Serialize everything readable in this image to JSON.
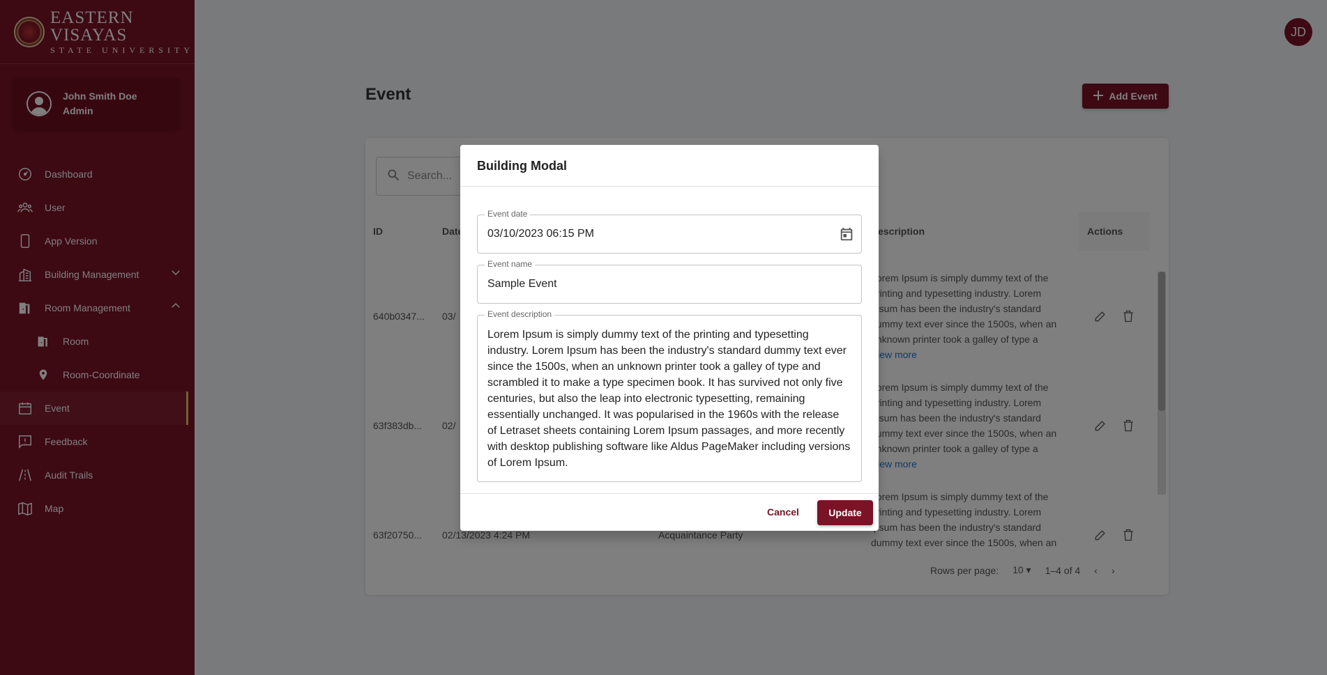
{
  "brand": {
    "line1": "EASTERN VISAYAS",
    "line2": "STATE UNIVERSITY"
  },
  "user": {
    "name": "John Smith Doe",
    "role": "Admin",
    "initials": "JD"
  },
  "sidebar": {
    "items": [
      {
        "label": "Dashboard",
        "icon": "dashboard-icon"
      },
      {
        "label": "User",
        "icon": "users-icon"
      },
      {
        "label": "App Version",
        "icon": "phone-icon"
      },
      {
        "label": "Building Management",
        "icon": "building-icon",
        "expand": "chevron-down-icon"
      },
      {
        "label": "Room Management",
        "icon": "door-icon",
        "expand": "chevron-up-icon"
      },
      {
        "label": "Room",
        "icon": "door-icon"
      },
      {
        "label": "Room-Coordinate",
        "icon": "pin-icon"
      },
      {
        "label": "Event",
        "icon": "calendar-icon",
        "active": true
      },
      {
        "label": "Feedback",
        "icon": "feedback-icon"
      },
      {
        "label": "Audit Trails",
        "icon": "road-icon"
      },
      {
        "label": "Map",
        "icon": "map-icon"
      }
    ]
  },
  "page": {
    "title": "Event",
    "add_button": "Add Event"
  },
  "table": {
    "search_placeholder": "Search...",
    "headers": {
      "id": "ID",
      "date": "Date",
      "description": "Description",
      "actions": "Actions"
    },
    "rows": [
      {
        "id": "640b0347...",
        "date": "03/",
        "desc": "Lorem Ipsum is simply dummy text of the printing and typesetting industry. Lorem Ipsum has been the industry's standard dummy text ever since the 1500s, when an unknown printer took a galley of type a",
        "view_more": "View more"
      },
      {
        "id": "63f383db...",
        "date": "02/",
        "desc": "Lorem Ipsum is simply dummy text of the printing and typesetting industry. Lorem Ipsum has been the industry's standard dummy text ever since the 1500s, when an unknown printer took a galley of type a",
        "view_more": "View more"
      },
      {
        "id": "63f20750...",
        "date": "02/13/2023 4:24 PM",
        "name": "Acquaintance Party",
        "desc": "Lorem Ipsum is simply dummy text of the printing and typesetting industry. Lorem Ipsum has been the industry's standard dummy text ever since the 1500s, when an"
      }
    ],
    "footer": {
      "rows_per_page_label": "Rows per page:",
      "rows_per_page": "10",
      "range": "1–4 of 4"
    }
  },
  "modal": {
    "title": "Building Modal",
    "date_label": "Event date",
    "date_value": "03/10/2023 06:15 PM",
    "name_label": "Event name",
    "name_value": "Sample Event",
    "desc_label": "Event description",
    "desc_value": "Lorem Ipsum is simply dummy text of the printing and typesetting industry. Lorem Ipsum has been the industry's standard dummy text ever since the 1500s, when an unknown printer took a galley of type and scrambled it to make a type specimen book. It has survived not only five centuries, but also the leap into electronic typesetting, remaining essentially unchanged. It was popularised in the 1960s with the release of Letraset sheets containing Lorem Ipsum passages, and more recently with desktop publishing software like Aldus PageMaker including versions of Lorem Ipsum.",
    "cancel": "Cancel",
    "update": "Update"
  },
  "colors": {
    "brand": "#7a1326",
    "accent": "#f0c05a",
    "link": "#1976d2"
  }
}
